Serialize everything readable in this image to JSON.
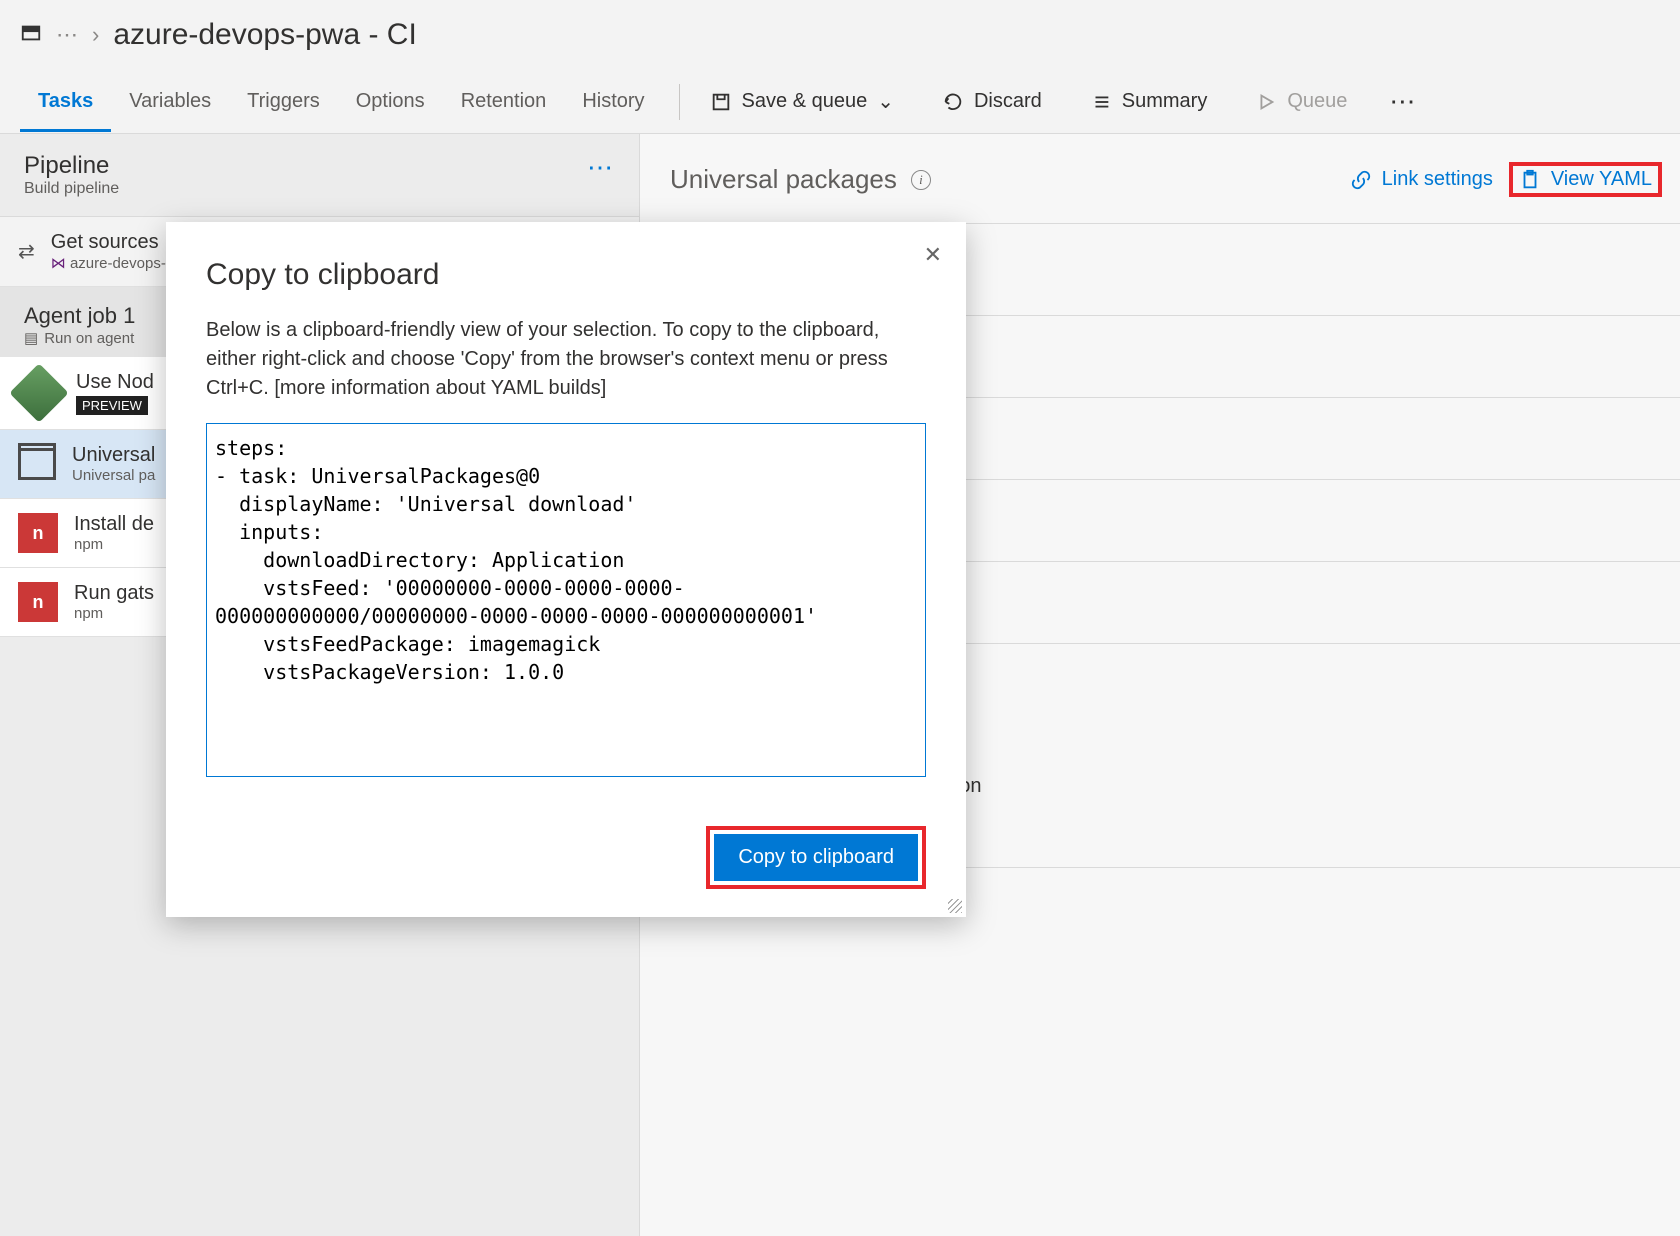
{
  "breadcrumb": {
    "title": "azure-devops-pwa - CI",
    "ellipsis": "⋯"
  },
  "tabs": {
    "items": [
      "Tasks",
      "Variables",
      "Triggers",
      "Options",
      "Retention",
      "History"
    ],
    "active": 0,
    "save": "Save & queue",
    "discard": "Discard",
    "summary": "Summary",
    "queue": "Queue",
    "more": "⋯"
  },
  "pipeline": {
    "title": "Pipeline",
    "sub": "Build pipeline",
    "get_sources": "Get sources",
    "repo": "azure-devops-"
  },
  "agent": {
    "title": "Agent job 1",
    "sub": "Run on agent"
  },
  "tasks": {
    "node": {
      "title": "Use Nod",
      "badge": "PREVIEW"
    },
    "universal": {
      "title": "Universal",
      "sub": "Universal pa"
    },
    "install": {
      "title": "Install de",
      "sub": "npm"
    },
    "gatsby": {
      "title": "Run gats",
      "sub": "npm"
    }
  },
  "panel": {
    "title": "Universal packages",
    "link_settings": "Link settings",
    "view_yaml": "View YAML",
    "radio_other": "Another organization/collection"
  },
  "modal": {
    "title": "Copy to clipboard",
    "description": "Below is a clipboard-friendly view of your selection. To copy to the clipboard, either right-click and choose 'Copy' from the browser's context menu or press Ctrl+C. [more information about YAML builds]",
    "yaml": "steps:\n- task: UniversalPackages@0\n  displayName: 'Universal download'\n  inputs:\n    downloadDirectory: Application\n    vstsFeed: '00000000-0000-0000-0000-000000000000/00000000-0000-0000-0000-000000000001'\n    vstsFeedPackage: imagemagick\n    vstsPackageVersion: 1.0.0\n",
    "copy_button": "Copy to clipboard"
  }
}
